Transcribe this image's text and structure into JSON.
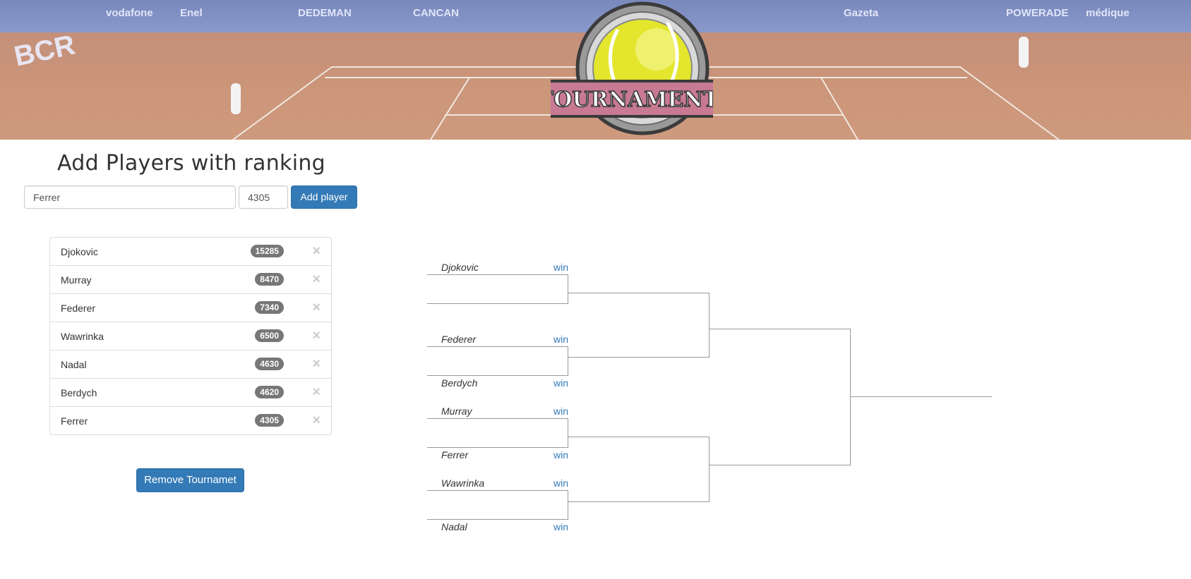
{
  "banner": {
    "logo_text": "TOURNAMENT",
    "sponsors": [
      "BCR",
      "vodafone",
      "Enel",
      "DEDEMAN",
      "CANCAN",
      "Gazeta",
      "POWERADE",
      "médique"
    ]
  },
  "form": {
    "heading": "Add Players with ranking",
    "name_value": "Ferrer",
    "rank_value": "4305",
    "add_button": "Add player"
  },
  "players": [
    {
      "name": "Djokovic",
      "points": "15285"
    },
    {
      "name": "Murray",
      "points": "8470"
    },
    {
      "name": "Federer",
      "points": "7340"
    },
    {
      "name": "Wawrinka",
      "points": "6500"
    },
    {
      "name": "Nadal",
      "points": "4630"
    },
    {
      "name": "Berdych",
      "points": "4620"
    },
    {
      "name": "Ferrer",
      "points": "4305"
    }
  ],
  "close_glyph": "×",
  "remove_button": "Remove Tournamet",
  "bracket": {
    "win_label": "win",
    "round1": [
      {
        "top": "Djokovic",
        "bottom": ""
      },
      {
        "top": "Federer",
        "bottom": "Berdych"
      },
      {
        "top": "Murray",
        "bottom": "Ferrer"
      },
      {
        "top": "Wawrinka",
        "bottom": "Nadal"
      }
    ]
  },
  "colors": {
    "primary": "#337ab7",
    "badge": "#777777",
    "bracket_line": "#999999"
  }
}
